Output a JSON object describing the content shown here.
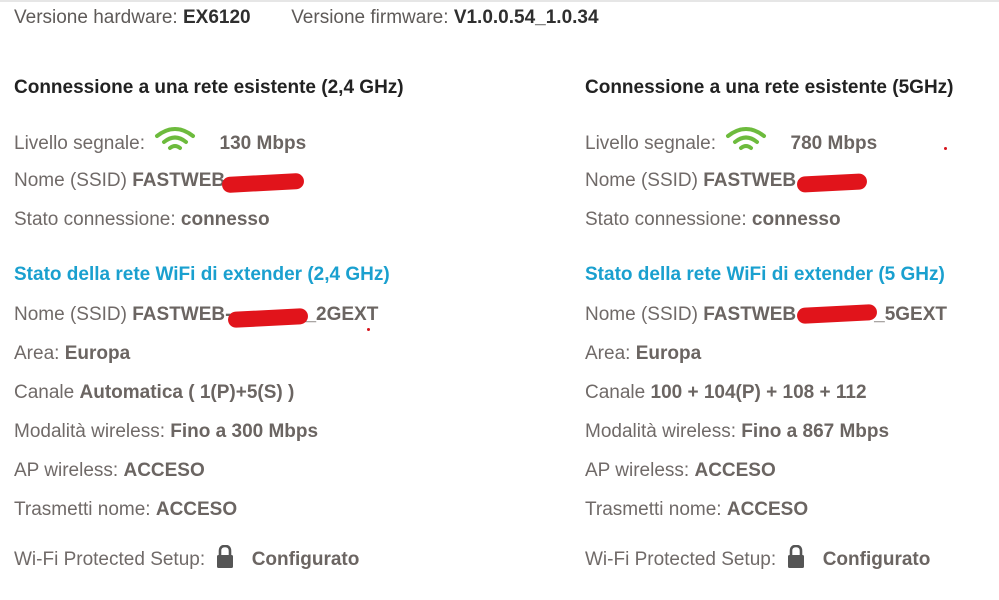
{
  "header": {
    "hw_label": "Versione hardware:",
    "hw_value": "EX6120",
    "fw_label": "Versione firmware:",
    "fw_value": "V1.0.0.54_1.0.34"
  },
  "left": {
    "heading": "Connessione a una rete esistente (2,4 GHz)",
    "signal_label": "Livello segnale:",
    "signal_value": "130 Mbps",
    "ssid_label": "Nome (SSID)",
    "ssid_value": "FASTWEB-",
    "status_label": "Stato connessione:",
    "status_value": "connesso",
    "ext_heading": "Stato della rete WiFi di extender (2,4 GHz)",
    "ext_ssid_label": "Nome (SSID)",
    "ext_ssid_value": "FASTWEB-",
    "ext_ssid_suffix": "_2GEXT",
    "area_label": "Area:",
    "area_value": "Europa",
    "channel_label": "Canale",
    "channel_value": "Automatica ( 1(P)+5(S) )",
    "mode_label": "Modalità wireless:",
    "mode_value": "Fino a 300 Mbps",
    "ap_label": "AP wireless:",
    "ap_value": "ACCESO",
    "broadcast_label": "Trasmetti nome:",
    "broadcast_value": "ACCESO",
    "wps_label": "Wi-Fi Protected Setup:",
    "wps_value": "Configurato"
  },
  "right": {
    "heading": "Connessione a una rete esistente (5GHz)",
    "signal_label": "Livello segnale:",
    "signal_value": "780 Mbps",
    "ssid_label": "Nome (SSID)",
    "ssid_value": "FASTWEB",
    "status_label": "Stato connessione:",
    "status_value": "connesso",
    "ext_heading": "Stato della rete WiFi di extender (5 GHz)",
    "ext_ssid_label": "Nome (SSID)",
    "ext_ssid_value": "FASTWEB",
    "ext_ssid_suffix": "_5GEXT",
    "area_label": "Area:",
    "area_value": "Europa",
    "channel_label": "Canale",
    "channel_value": "100 + 104(P) + 108 + 112",
    "mode_label": "Modalità wireless:",
    "mode_value": "Fino a 867 Mbps",
    "ap_label": "AP wireless:",
    "ap_value": "ACCESO",
    "broadcast_label": "Trasmetti nome:",
    "broadcast_value": "ACCESO",
    "wps_label": "Wi-Fi Protected Setup:",
    "wps_value": "Configurato"
  },
  "icons": {
    "wifi": "wifi-signal-icon",
    "lock": "lock-icon"
  },
  "colors": {
    "wifi_green": "#6dbb3d",
    "heading_blue": "#1aa0cf",
    "redaction_red": "#e1141b"
  }
}
